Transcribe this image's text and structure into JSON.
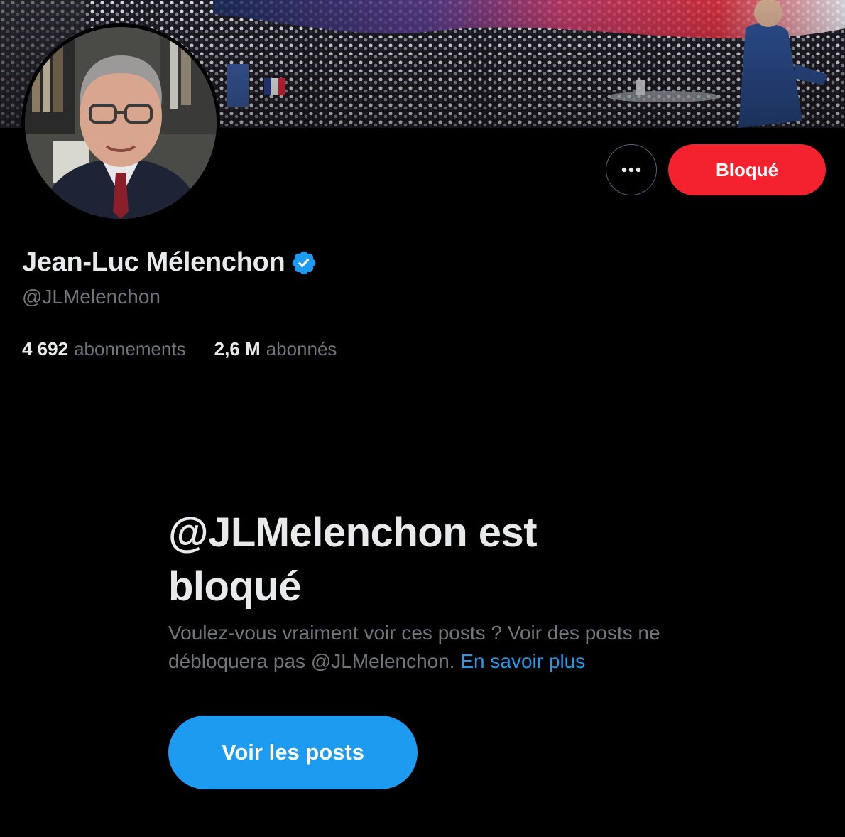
{
  "profile": {
    "display_name": "Jean-Luc Mélenchon",
    "handle": "@JLMelenchon",
    "verified_icon": "verified-badge-icon",
    "following_count": "4 692",
    "following_label": "abonnements",
    "followers_count": "2,6 M",
    "followers_label": "abonnés"
  },
  "actions": {
    "more_icon": "more-options-icon",
    "blocked_label": "Bloqué"
  },
  "blocked_notice": {
    "title": "@JLMelenchon est bloqué",
    "description": "Voulez-vous vraiment voir ces posts ? Voir des posts ne débloquera pas @JLMelenchon.",
    "learn_more": "En savoir plus",
    "view_posts_label": "Voir les posts"
  },
  "colors": {
    "background": "#000000",
    "text_primary": "#e7e9ea",
    "text_secondary": "#71767b",
    "accent_blue": "#1d9bf0",
    "blocked_red": "#f4212e",
    "border": "#536471"
  }
}
